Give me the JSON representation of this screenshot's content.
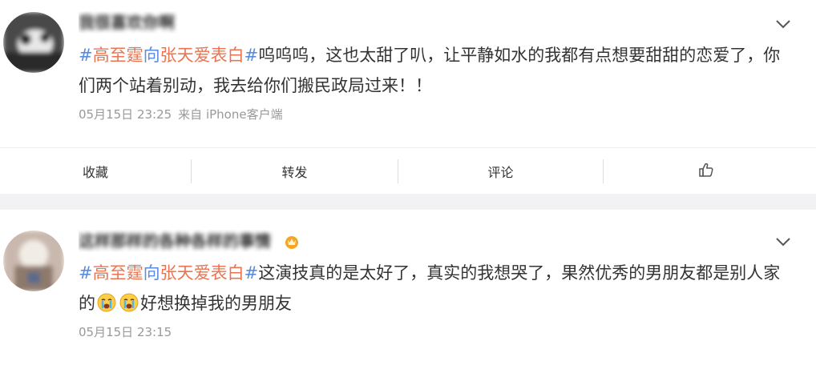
{
  "posts": [
    {
      "username": "我很喜欢你啊",
      "text_pre": "",
      "hashtag_part1": "高至霆",
      "hashtag_part2": "向",
      "hashtag_part3": "张天爱表白",
      "text_body": "呜呜呜，这也太甜了叭，让平静如水的我都有点想要甜甜的恋爱了，你们两个站着别动，我去给你们搬民政局过来！！",
      "timestamp": "05月15日 23:25",
      "source": "来自 iPhone客户端",
      "avatar_color": "#3a3a3a"
    },
    {
      "username": "这样那样的各种各样的事情",
      "hashtag_part1": "高至霆",
      "hashtag_part2": "向",
      "hashtag_part3": "张天爱表白",
      "text_body": "这演技真的是太好了，真实的我想哭了，果然优秀的男朋友都是别人家的",
      "text_after_emoji": "好想换掉我的男朋友",
      "timestamp": "05月15日 23:15",
      "avatar_color": "#a88f80"
    }
  ],
  "actions": {
    "collect_label": "收藏",
    "repost_label": "转发",
    "comment_label": "评论",
    "like_icon": "thumbs-up-icon"
  },
  "icons": {
    "menu": "chevron-down-icon",
    "emoji": "crying-face-emoji"
  },
  "colors": {
    "hashtag_symbol": "#5a8be0",
    "hashtag_text": "#eb7350",
    "meta": "#999999",
    "background": "#f2f2f5"
  }
}
